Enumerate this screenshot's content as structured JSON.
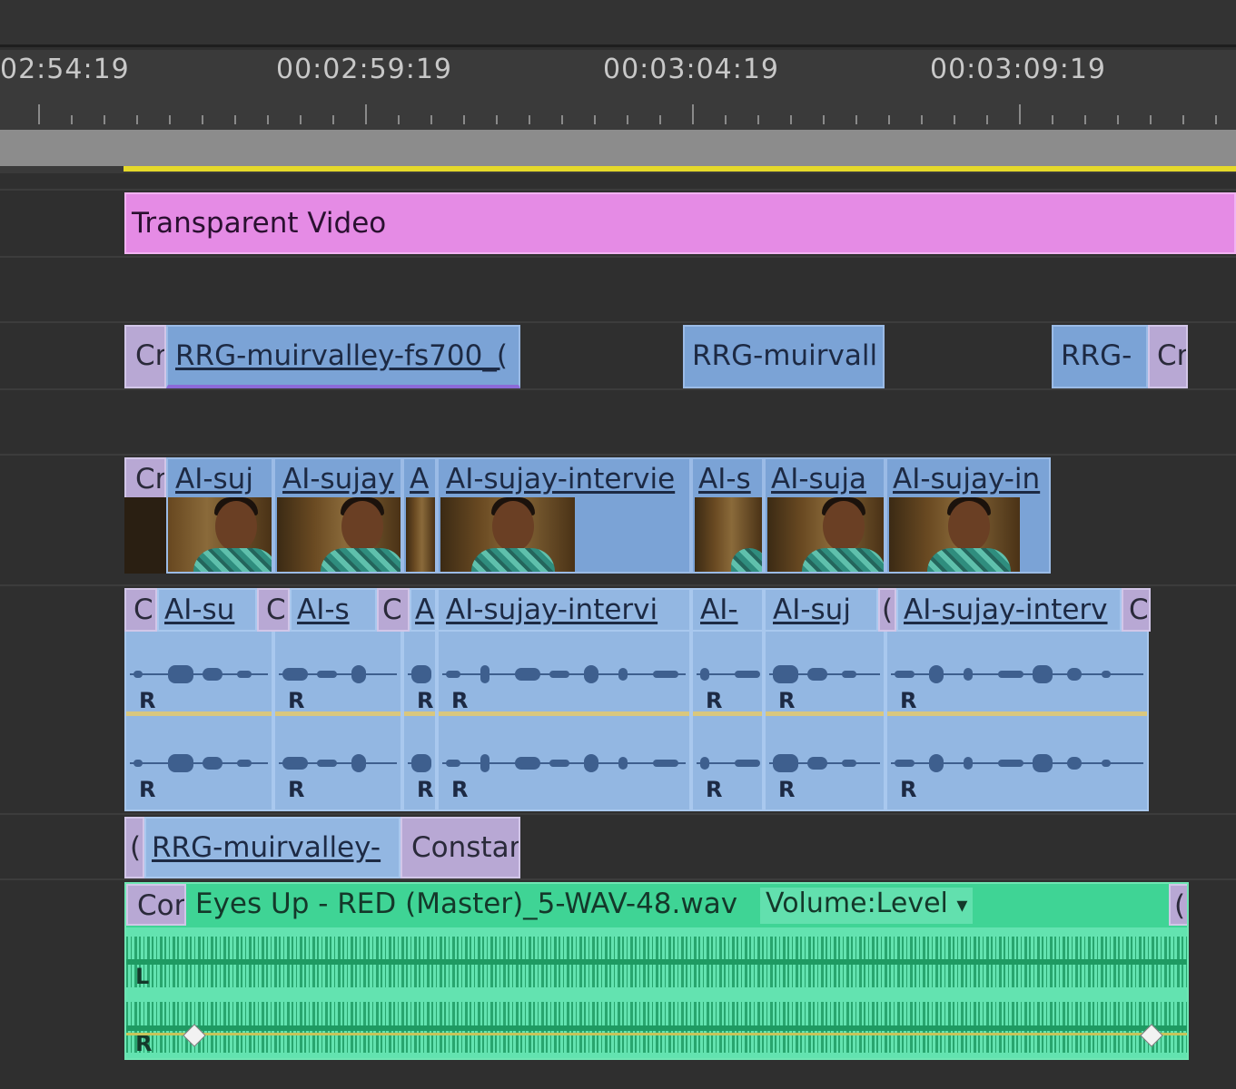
{
  "ruler": {
    "timecodes": [
      "02:54:19",
      "00:02:59:19",
      "00:03:04:19",
      "00:03:09:19"
    ]
  },
  "tracks": {
    "v3": {
      "clip_label": "Transparent Video",
      "color": "#e58be5"
    },
    "v2": {
      "clips": [
        "Cr",
        "RRG-muirvalley-fs700_(",
        "RRG-muirvall",
        "RRG-",
        "Cr"
      ]
    },
    "v1": {
      "clips": [
        "Cr",
        "AI-suj",
        "AI-sujay",
        "A",
        "AI-sujay-intervie",
        "AI-s",
        "AI-suja",
        "AI-sujay-in"
      ]
    },
    "a1": {
      "clips": [
        "C",
        "AI-su",
        "C",
        "AI-s",
        "C",
        "A",
        "AI-sujay-intervi",
        "AI-",
        "AI-suj",
        "(",
        "AI-sujay-interv",
        "C"
      ],
      "channel_mark": "R"
    },
    "a2": {
      "clips": [
        "(",
        "RRG-muirvalley-",
        "Constar"
      ]
    },
    "a3": {
      "trans_label": "Cor",
      "clip_label": "Eyes Up - RED (Master)_5-WAV-48.wav",
      "effect": "Volume:Level",
      "dropdown": "▾",
      "end_label": "(",
      "channel_left": "L",
      "channel_right": "R",
      "color": "#3fd495"
    }
  }
}
